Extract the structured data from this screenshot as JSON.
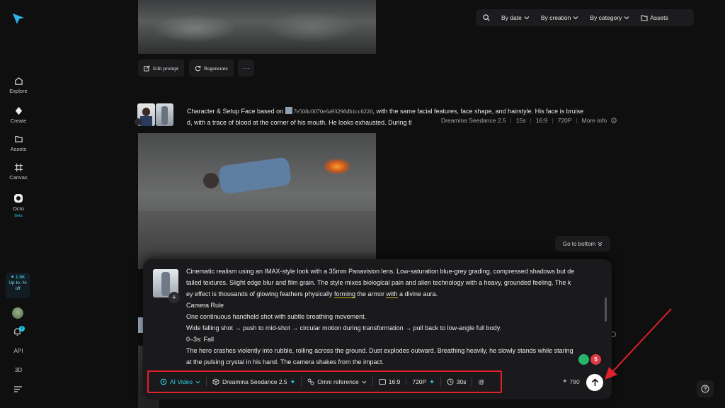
{
  "sidebar": {
    "items": [
      {
        "label": "Explore",
        "icon": "home-icon"
      },
      {
        "label": "Create",
        "icon": "diamond-icon"
      },
      {
        "label": "Assets",
        "icon": "folder-icon"
      },
      {
        "label": "Canvas",
        "icon": "canvas-icon"
      },
      {
        "label": "Octo",
        "icon": "octo-icon",
        "badge": "Beta"
      }
    ],
    "promo": {
      "line1": "✦ 1.8K",
      "line2": "Up to -%",
      "line3": "off"
    },
    "notification_count": "2",
    "bottom_items": [
      "API",
      "3D"
    ]
  },
  "topbar": {
    "by_date": "By date",
    "by_creation": "By creation",
    "by_category": "By category",
    "assets": "Assets"
  },
  "actions": {
    "edit_prompt": "Edit prompt",
    "regenerate": "Regenerate",
    "more": "···"
  },
  "history_item": {
    "prompt_line1_a": "Character & Setup Face based on ",
    "prompt_ref": "7e508c0070e6a93298db1cc6220",
    "prompt_line1_b": ", with the same facial features, face shape, and hairstyle. His face is bruise",
    "prompt_line2": "d, with a trace of blood at the corner of his mouth. He looks exhausted. During tl",
    "meta": {
      "model": "Dreamina Seedance 2.5",
      "duration": "15s",
      "ratio": "16:9",
      "resolution": "720P",
      "more": "More info"
    }
  },
  "go_to_bottom": "Go to bottom",
  "composer": {
    "line1": "Cinematic realism using an IMAX-style look with a 35mm Panavision lens. Low-saturation blue-grey grading, compressed shadows but de",
    "line2": "tailed textures. Slight edge blur and film grain. The style mixes biological pain and alien technology with a heavy, grounded feeling. The k",
    "line3_a": "ey effect is thousands of glowing feathers physically ",
    "line3_u1": "forming",
    "line3_b": " the armor ",
    "line3_u2": "with",
    "line3_c": " a divine aura.",
    "line4": "Camera Rule",
    "line5": "One continuous handheld shot with subtle breathing movement.",
    "line6": "Wide falling shot → push to mid-shot → circular motion during transformation → pull back to low-angle full body.",
    "line7": "0–3s: Fall",
    "line8": "The hero crashes violently into rubble, rolling across the ground. Dust explodes outward. Breathing heavily, he slowly stands while staring",
    "line9": "at the pulsing crystal in his hand. The camera shakes from the impact.",
    "badge_count": "5",
    "toolbar": {
      "mode": "AI Video",
      "model": "Dreamina Seedance 2.5",
      "reference": "Omni reference",
      "ratio": "16:9",
      "resolution": "720P",
      "duration": "30s",
      "mention": "@"
    },
    "credits": "780"
  },
  "colors": {
    "accent": "#2ad0e8",
    "highlight_box": "#e0202a",
    "underline": "#d4b02a"
  }
}
